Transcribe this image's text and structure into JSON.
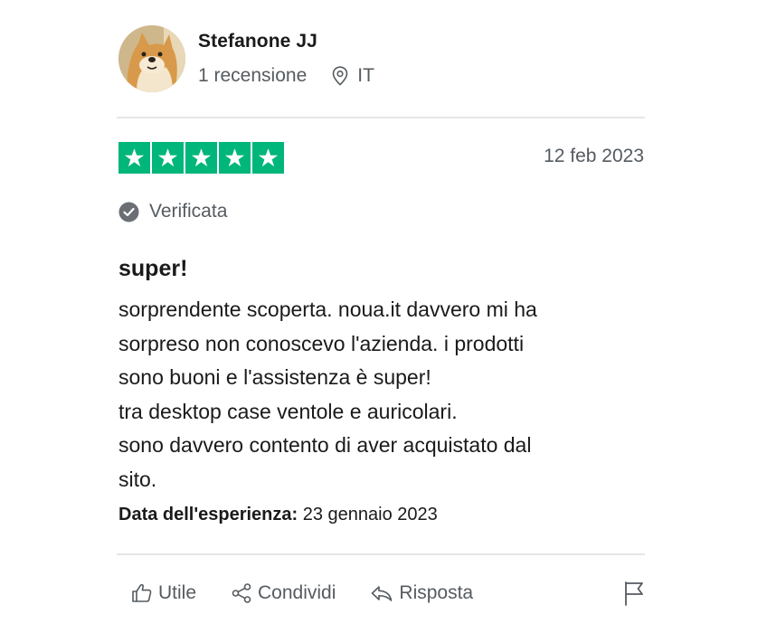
{
  "author": {
    "name": "Stefanone JJ",
    "review_count": "1 recensione",
    "country": "IT",
    "avatar_icon": "shiba-dog-avatar"
  },
  "review": {
    "rating": 5,
    "rating_max": 5,
    "star_color": "#00b67a",
    "date": "12 feb 2023",
    "verified_label": "Verificata",
    "title": "super!",
    "body_lines": [
      "sorprendente scoperta. noua.it davvero mi ha",
      "sorpreso non conoscevo l'azienda. i prodotti",
      "sono buoni e l'assistenza è super!",
      "tra desktop case ventole e auricolari.",
      "sono davvero contento di aver acquistato dal",
      "sito."
    ],
    "experience_label": "Data dell'esperienza:",
    "experience_date": "23 gennaio 2023"
  },
  "actions": {
    "useful": "Utile",
    "share": "Condividi",
    "reply": "Risposta",
    "useful_icon": "thumbs-up-icon",
    "share_icon": "share-icon",
    "reply_icon": "reply-icon",
    "flag_icon": "flag-icon"
  }
}
